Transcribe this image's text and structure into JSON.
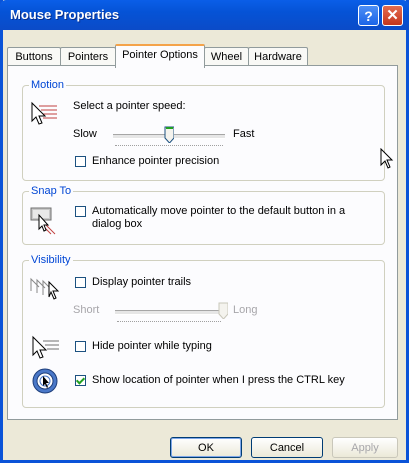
{
  "window": {
    "title": "Mouse Properties",
    "help_label": "?",
    "close_label": "✕"
  },
  "tabs": [
    {
      "label": "Buttons"
    },
    {
      "label": "Pointers"
    },
    {
      "label": "Pointer Options"
    },
    {
      "label": "Wheel"
    },
    {
      "label": "Hardware"
    }
  ],
  "motion": {
    "legend": "Motion",
    "speed_label": "Select a pointer speed:",
    "slow_label": "Slow",
    "fast_label": "Fast",
    "speed_level": 0.5,
    "precision_label": "Enhance pointer precision",
    "precision_checked": false,
    "icon": "pointer-speed-icon"
  },
  "snapto": {
    "legend": "Snap To",
    "label_line1": "Automatically move pointer to the default button in a",
    "label_line2": "dialog box",
    "checked": false,
    "icon": "snap-to-icon"
  },
  "visibility": {
    "legend": "Visibility",
    "trails_label": "Display pointer trails",
    "trails_checked": false,
    "short_label": "Short",
    "long_label": "Long",
    "trail_level": 1.0,
    "hide_label": "Hide pointer while typing",
    "hide_checked": false,
    "show_label": "Show location of pointer when I press the CTRL key",
    "show_checked": true,
    "icons": [
      "pointer-trails-icon",
      "hide-pointer-icon",
      "show-location-icon"
    ]
  },
  "buttons": {
    "ok": "OK",
    "cancel": "Cancel",
    "apply": "Apply"
  },
  "colors": {
    "title_bar": "#0553d6",
    "legend": "#0046d5",
    "tab_highlight": "#f4a34a",
    "check": "#21a121"
  }
}
